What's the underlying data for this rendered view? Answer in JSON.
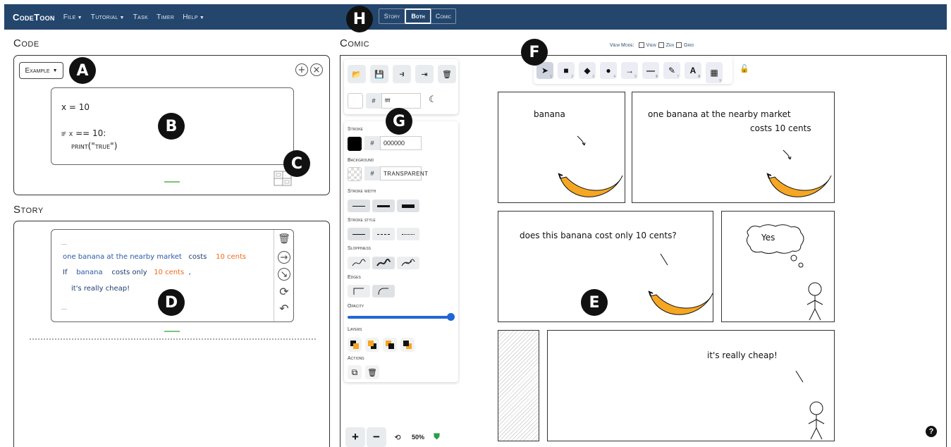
{
  "nav": {
    "brand": "CodeToon",
    "menus": [
      {
        "label": "File",
        "caret": true
      },
      {
        "label": "Tutorial",
        "caret": true
      },
      {
        "label": "Task",
        "caret": false
      },
      {
        "label": "Timer",
        "caret": false
      },
      {
        "label": "Help",
        "caret": true
      }
    ],
    "modes": [
      "Story",
      "Both",
      "Comic"
    ],
    "active_mode": "Both"
  },
  "badges": [
    "A",
    "B",
    "C",
    "D",
    "E",
    "F",
    "G",
    "H"
  ],
  "code": {
    "title": "Code",
    "dropdown": "Example",
    "lines": [
      "x = 10",
      "if x == 10:",
      "print(\"true\")"
    ]
  },
  "story": {
    "title": "Story",
    "lines": [
      {
        "tokens": [
          {
            "t": "one banana at the nearby market",
            "c": "blue"
          },
          {
            "t": "costs",
            "c": "navy"
          },
          {
            "t": "10 cents",
            "c": "orange"
          }
        ]
      },
      {
        "tokens": [
          {
            "t": "If",
            "c": "navy"
          },
          {
            "t": "banana",
            "c": "blue"
          },
          {
            "t": "costs only",
            "c": "navy"
          },
          {
            "t": "10 cents",
            "c": "orange"
          },
          {
            "t": ",",
            "c": "navy"
          }
        ]
      },
      {
        "tokens": [
          {
            "t": "it's really cheap!",
            "c": "navy"
          }
        ]
      }
    ]
  },
  "comic": {
    "title": "Comic",
    "view_mode_label": "View Mode:",
    "view_modes": [
      "View",
      "Zen",
      "Grid"
    ],
    "color_hex": "ffff",
    "stroke_label": "Stroke",
    "stroke_hex": "000000",
    "background_label": "Background",
    "background_value": "transparent",
    "hash": "#",
    "stroke_width_label": "Stroke width",
    "stroke_style_label": "Stroke style",
    "sloppiness_label": "Sloppiness",
    "edges_label": "Edges",
    "opacity_label": "Opacity",
    "opacity_value": 1.0,
    "layers_label": "Layers",
    "actions_label": "Actions",
    "zoom": "50%",
    "tool_numbers": [
      "1",
      "2",
      "3",
      "4",
      "5",
      "6",
      "7",
      "8",
      "9"
    ],
    "panels": {
      "p1": "banana",
      "p2a": "one banana at the nearby market",
      "p2b": "costs 10 cents",
      "p3": "does this banana cost only 10 cents?",
      "p4": "Yes",
      "p6": "it's really cheap!"
    }
  },
  "colors": {
    "navbar": "#24466d",
    "banana": "#f5a623",
    "accent_green": "#7bc47b",
    "slider": "#2166d6"
  }
}
